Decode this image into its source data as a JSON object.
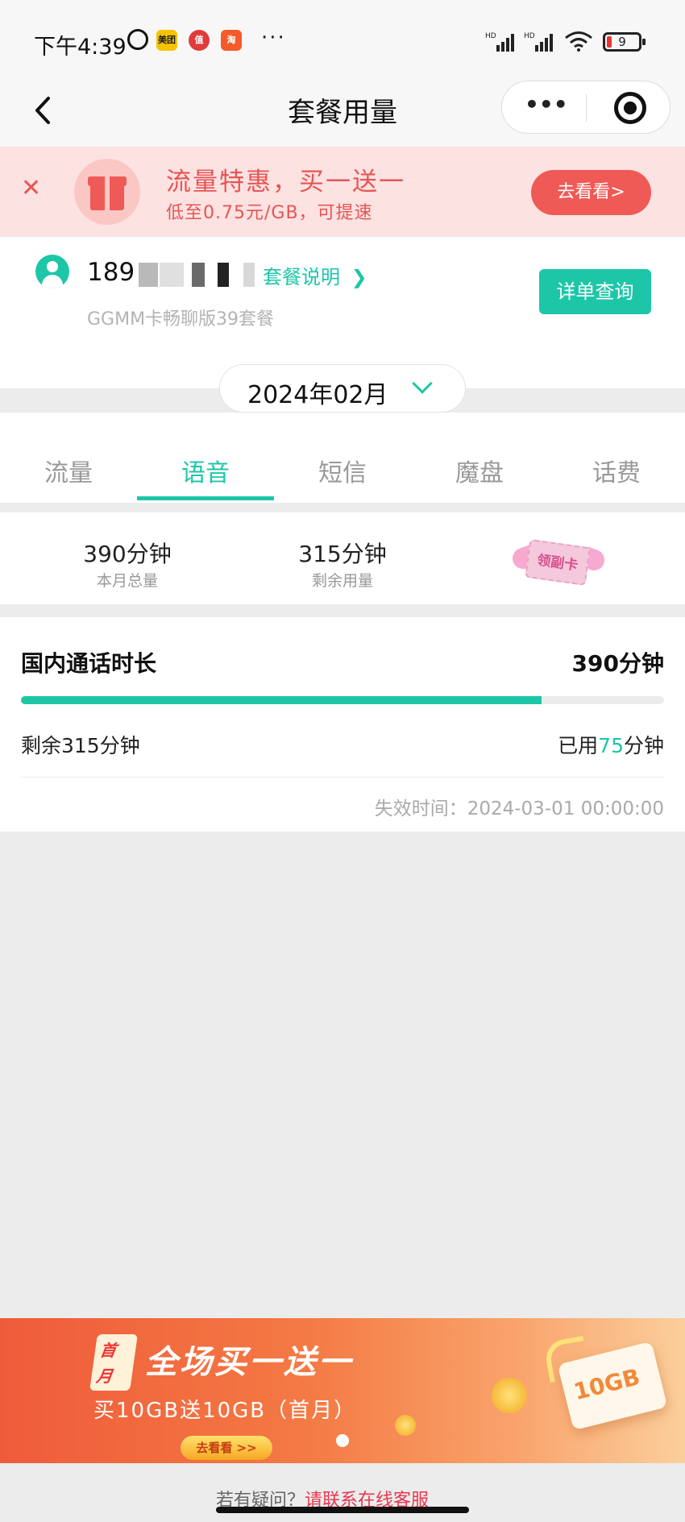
{
  "status_bar": {
    "time": "下午4:39",
    "app_icons": [
      "美团",
      "值",
      "淘"
    ],
    "more": "···",
    "signal_labels": [
      "HD",
      "HD"
    ],
    "battery": "9"
  },
  "nav": {
    "title": "套餐用量",
    "more": "•••"
  },
  "promo": {
    "title": "流量特惠，买一送一",
    "subtitle": "低至0.75元/GB，可提速",
    "button": "去看看>"
  },
  "account": {
    "phone_prefix": "189",
    "plan_link": "套餐说明",
    "plan_name": "GGMM卡畅聊版39套餐",
    "detail_button": "详单查询"
  },
  "month": {
    "label": "2024年02月"
  },
  "tabs": [
    "流量",
    "语音",
    "短信",
    "魔盘",
    "话费"
  ],
  "active_tab": 1,
  "summary": {
    "total_value": "390分钟",
    "total_label": "本月总量",
    "remain_value": "315分钟",
    "remain_label": "剩余用量",
    "card_text": "领副卡"
  },
  "calls": {
    "title": "国内通话时长",
    "total": "390分钟",
    "used_fraction": 0.81,
    "remain_text": "剩余315分钟",
    "used_prefix": "已用",
    "used_number": "75",
    "used_suffix": "分钟",
    "expire": "失效时间：2024-03-01 00:00:00"
  },
  "ad_banner": {
    "badge_top": "首",
    "badge_bottom": "月",
    "headline": "全场买一送一",
    "subline": "买10GB送10GB（首月）",
    "cta": "去看看 >>",
    "card_text": "10GB"
  },
  "footer": {
    "text_gray": "若有疑问？",
    "text_red": "请联系在线客服"
  },
  "colors": {
    "accent": "#1ec6a8",
    "promo_red": "#ef5a56",
    "promo_bg": "#fde2e2"
  }
}
